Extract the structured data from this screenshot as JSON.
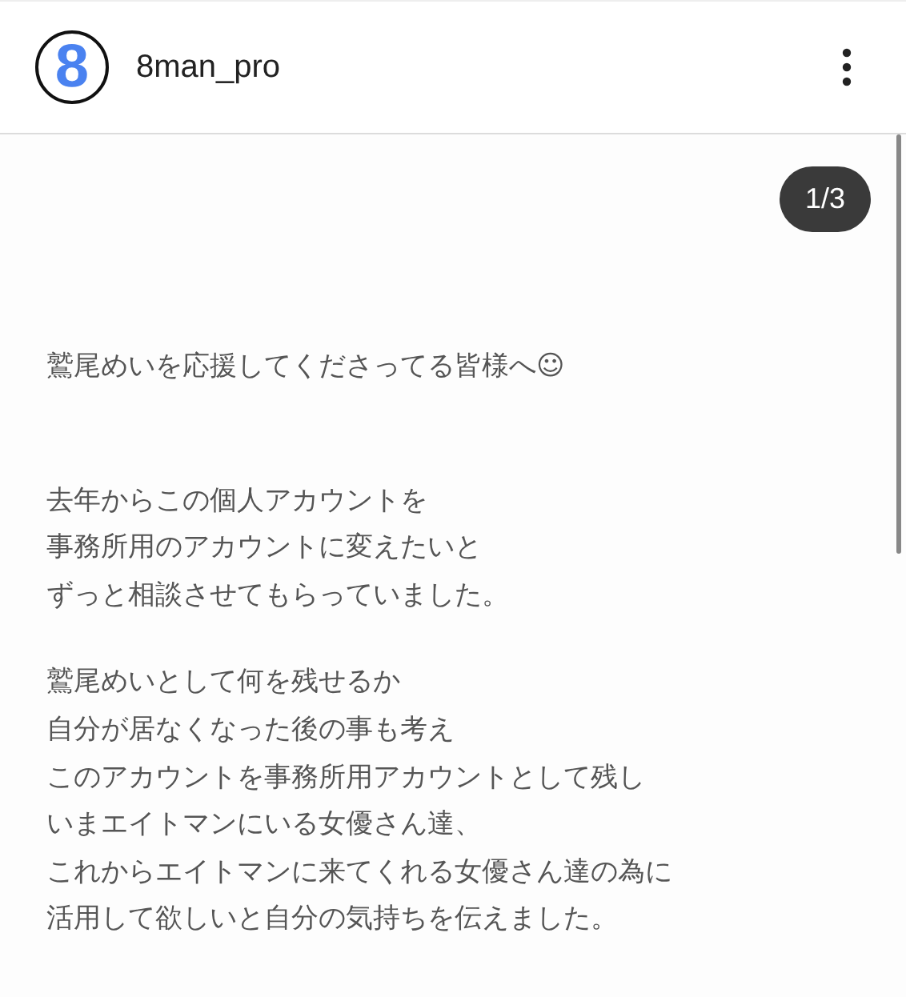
{
  "header": {
    "avatar_text": "8",
    "username": "8man_pro"
  },
  "post": {
    "counter": "1/3",
    "paragraphs": [
      [
        "鷲尾めいを応援してくださってる皆様へ☺"
      ],
      [
        "去年からこの個人アカウントを",
        "事務所用のアカウントに変えたいと",
        "ずっと相談させてもらっていました。"
      ],
      [
        "鷲尾めいとして何を残せるか",
        "自分が居なくなった後の事も考え",
        "このアカウントを事務所用アカウントとして残し",
        "いまエイトマンにいる女優さん達、",
        "これからエイトマンに来てくれる女優さん達の為に",
        "活用して欲しいと自分の気持ちを伝えました。"
      ]
    ]
  }
}
